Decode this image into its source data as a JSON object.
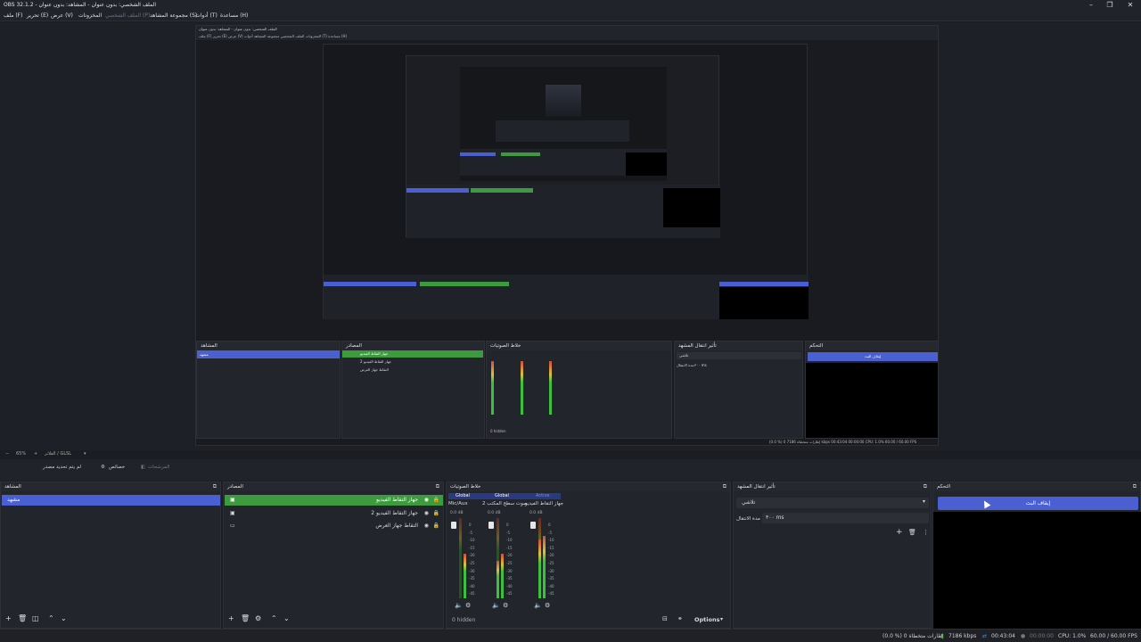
{
  "window": {
    "title": "OBS 32.1.2 - الملف الشخصي: بدون عنوان - المشاهد: بدون عنوان"
  },
  "menu": {
    "items": [
      "ملف (F)",
      "تحرير (E)",
      "عرض (V)",
      "المخزونات",
      "الملف الشخصي (P)",
      "مجموعة المشاهد (S)",
      "أدوات (T)",
      "مساعدة (H)"
    ]
  },
  "nested": {
    "title": "الملف الشخصي: بدون عنوان - المشاهد: بدون عنوان",
    "menu": "ملف (F)  تحرير (E)  عرض (V)  المخزونات  الملف الشخصي  مجموعة المشاهد  أدوات (T)  مساعدة (H)",
    "scenes_label": "المشاهد",
    "scene": "مشهد",
    "sources_label": "المصادر",
    "sources": [
      "جهاز التقاط الفيديو",
      "جهاز التقاط الفيديو 2",
      "التقاط جهاز العرض"
    ],
    "mixer_label": "خلاط الصوتيات",
    "hidden": "0 hidden",
    "transitions_label": "تأثير انتقال المشهد",
    "transition": "تلاشي",
    "duration_label": "مدة الانتقال",
    "duration": "٣٠٠ ms",
    "controls_label": "التحكم",
    "stop": "إيقاف البث",
    "options": "Options",
    "status": "(0.0 %) 0 إطارات متخطاة   7186 kbps   00:43:04   00:00:00   CPU: 1.0%   60.00 / 60.00 FPS"
  },
  "toolbar": {
    "zoom": "65%",
    "scene_sel": "الفلاتر / GLSL",
    "no_source": "لم يتم تحديد مصدر",
    "properties": "خصائص",
    "filters": "المرشحات"
  },
  "docks": {
    "scenes": {
      "label": "المشاهد",
      "items": [
        "مشهد"
      ]
    },
    "sources": {
      "label": "المصادر",
      "items": [
        "جهاز التقاط الفيديو",
        "جهاز التقاط الفيديو 2",
        "التقاط جهاز العرض"
      ]
    },
    "mixer": {
      "label": "خلاط الصوتيات",
      "tabs": [
        "Global",
        "Global",
        "Active"
      ],
      "channels": [
        {
          "name": "Mic/Aux",
          "db": "0.0 dB"
        },
        {
          "name": "صوت سطح المكتب 2",
          "db": "0.0 dB"
        },
        {
          "name": "جهاز التقاط الفيديو",
          "db": "0.0 dB"
        }
      ],
      "ticks": [
        "0",
        "-5",
        "-10",
        "-15",
        "-20",
        "-25",
        "-30",
        "-35",
        "-40",
        "-45",
        "-50",
        "-55",
        "-60"
      ],
      "hidden": "0 hidden",
      "options": "Options"
    },
    "transitions": {
      "label": "تأثير انتقال المشهد",
      "transition": "تلاشي",
      "duration_label": "مدة الانتقال",
      "duration": "٣٠٠ ms"
    },
    "controls": {
      "label": "التحكم",
      "stop_stream": "إيقاف البث"
    }
  },
  "status": {
    "dropped": "(0.0 %) 0 إطارات متخطاة",
    "bitrate": "7186 kbps",
    "stream_time": "00:43:04",
    "rec_time": "00:00:00",
    "cpu": "CPU: 1.0%",
    "fps": "60.00 / 60.00 FPS"
  },
  "colors": {
    "accent": "#4a5fd1",
    "source_selected": "#3d9a3f",
    "bg": "#1b1d23"
  }
}
